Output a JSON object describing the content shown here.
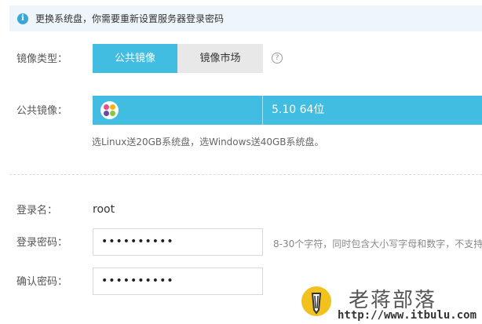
{
  "notice": {
    "icon": "info-icon",
    "text": "更换系统盘，你需要重新设置服务器登录密码"
  },
  "image_type": {
    "label": "镜像类型：",
    "tabs": [
      {
        "label": "公共镜像",
        "active": true
      },
      {
        "label": "镜像市场",
        "active": false
      }
    ],
    "help_icon": "question-circle-icon"
  },
  "public_image": {
    "label": "公共镜像：",
    "os_icon": "os-logo-icon",
    "version": "5.10 64位",
    "hint": "选Linux送20GB系统盘，选Windows送40GB系统盘。"
  },
  "login": {
    "username_label": "登录名：",
    "username_value": "root",
    "password_label": "登录密码：",
    "password_value": "••••••••••",
    "password_hint": "8-30个字符，同时包含大小写字母和数字，不支持",
    "confirm_label": "确认密码：",
    "confirm_value": "••••••••••"
  },
  "watermark": {
    "title": "老蒋部落",
    "url": "http://www.itbulu.com"
  },
  "colors": {
    "accent": "#41bde1",
    "notice_bg": "#eef6fb",
    "watermark_badge": "#f3c11e"
  }
}
